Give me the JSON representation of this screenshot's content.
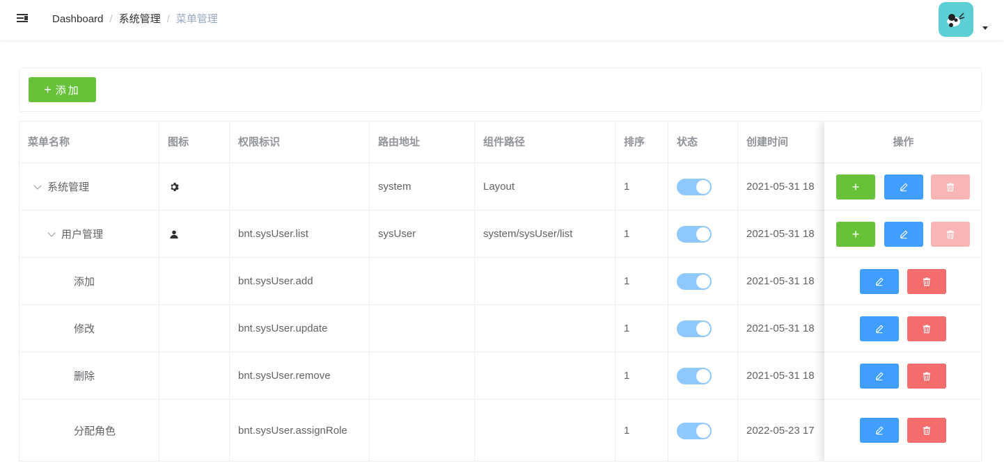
{
  "navbar": {
    "breadcrumb": [
      "Dashboard",
      "系统管理",
      "菜单管理"
    ],
    "separator": "/"
  },
  "toolbar": {
    "add_icon": "+",
    "add_label": "添加"
  },
  "table": {
    "columns": [
      "菜单名称",
      "图标",
      "权限标识",
      "路由地址",
      "组件路径",
      "排序",
      "状态",
      "创建时间",
      "操作"
    ],
    "rows": [
      {
        "name": "系统管理",
        "icon": "gear-icon",
        "perms": "",
        "path": "system",
        "component": "Layout",
        "sort": "1",
        "status": true,
        "created": "2021-05-31 18",
        "expandable": true,
        "level": 0,
        "actions": [
          "add",
          "edit",
          "delete-disabled"
        ]
      },
      {
        "name": "用户管理",
        "icon": "user-icon",
        "perms": "bnt.sysUser.list",
        "path": "sysUser",
        "component": "system/sysUser/list",
        "sort": "1",
        "status": true,
        "created": "2021-05-31 18",
        "expandable": true,
        "level": 1,
        "actions": [
          "add",
          "edit",
          "delete-disabled"
        ]
      },
      {
        "name": "添加",
        "icon": "",
        "perms": "bnt.sysUser.add",
        "path": "",
        "component": "",
        "sort": "1",
        "status": true,
        "created": "2021-05-31 18",
        "expandable": false,
        "level": 2,
        "actions": [
          "edit",
          "delete"
        ]
      },
      {
        "name": "修改",
        "icon": "",
        "perms": "bnt.sysUser.update",
        "path": "",
        "component": "",
        "sort": "1",
        "status": true,
        "created": "2021-05-31 18",
        "expandable": false,
        "level": 2,
        "actions": [
          "edit",
          "delete"
        ]
      },
      {
        "name": "删除",
        "icon": "",
        "perms": "bnt.sysUser.remove",
        "path": "",
        "component": "",
        "sort": "1",
        "status": true,
        "created": "2021-05-31 18",
        "expandable": false,
        "level": 2,
        "actions": [
          "edit",
          "delete"
        ]
      },
      {
        "name": "分配角色",
        "icon": "",
        "perms": "bnt.sysUser.assignRole",
        "path": "",
        "component": "",
        "sort": "1",
        "status": true,
        "created": "2022-05-23 17",
        "expandable": false,
        "level": 2,
        "actions": [
          "edit",
          "delete"
        ]
      }
    ]
  },
  "action_glyphs": {
    "add": "+"
  },
  "colors": {
    "success": "#67c23a",
    "primary": "#409eff",
    "danger": "#f56c6c",
    "danger_disabled": "#fab6b6",
    "switch_on": "#8fc7ff"
  }
}
